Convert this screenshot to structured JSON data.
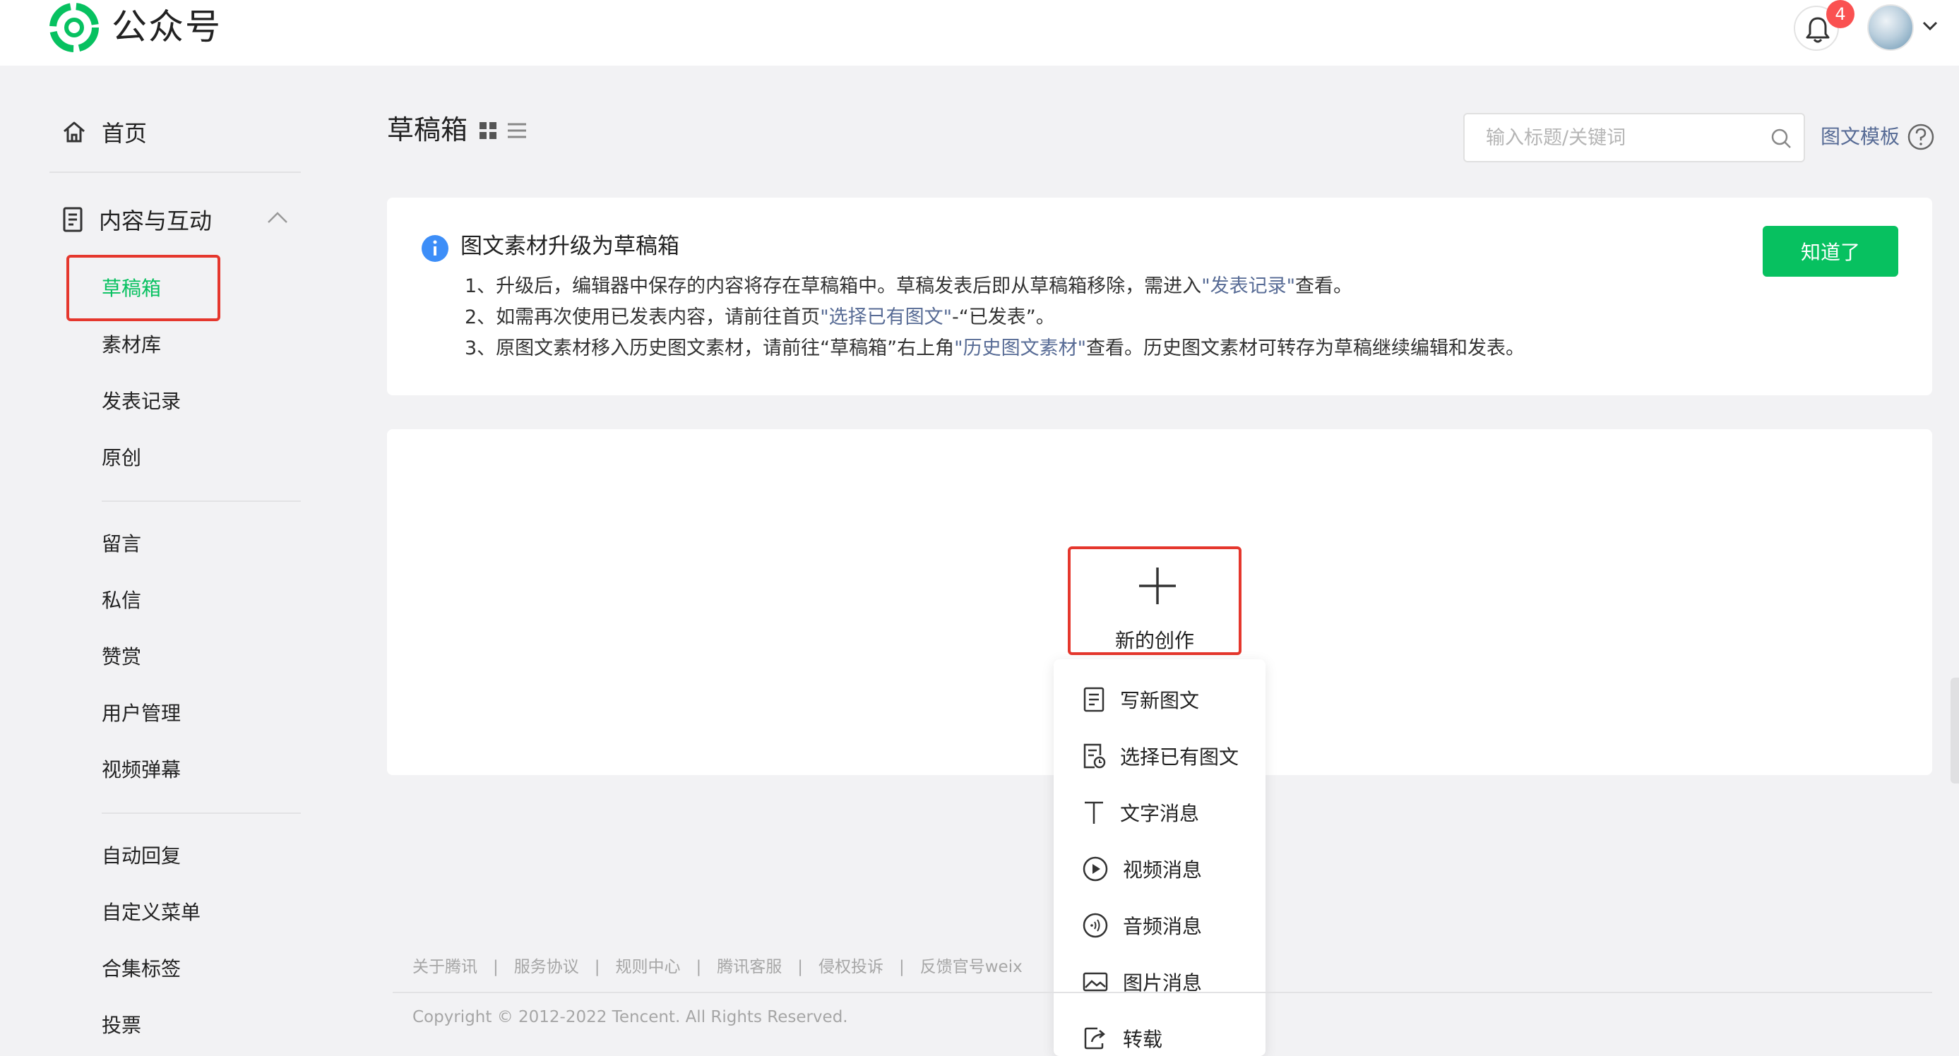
{
  "header": {
    "brand": "公众号",
    "notification_count": "4"
  },
  "sidebar": {
    "home_label": "首页",
    "group_label": "内容与互动",
    "items": [
      {
        "label": "草稿箱",
        "active": true
      },
      {
        "label": "素材库"
      },
      {
        "label": "发表记录"
      },
      {
        "label": "原创"
      },
      {
        "label": "留言"
      },
      {
        "label": "私信"
      },
      {
        "label": "赞赏"
      },
      {
        "label": "用户管理"
      },
      {
        "label": "视频弹幕"
      },
      {
        "label": "自动回复"
      },
      {
        "label": "自定义菜单"
      },
      {
        "label": "合集标签"
      },
      {
        "label": "投票"
      }
    ]
  },
  "main": {
    "title": "草稿箱",
    "search_placeholder": "输入标题/关键词",
    "template_link": "图文模板"
  },
  "notice": {
    "title": "图文素材升级为草稿箱",
    "line1_a": "1、升级后，编辑器中保存的内容将存在草稿箱中。草稿发表后即从草稿箱移除，需进入",
    "line1_link": "\"发表记录\"",
    "line1_b": "查看。",
    "line2_a": "2、如需再次使用已发表内容，请前往首页",
    "line2_link": "\"选择已有图文\"",
    "line2_b": "-“已发表”。",
    "line3_a": "3、原图文素材移入历史图文素材，请前往“草稿箱”右上角",
    "line3_link": "\"历史图文素材\"",
    "line3_b": "查看。历史图文素材可转存为草稿继续编辑和发表。",
    "button": "知道了"
  },
  "create": {
    "label": "新的创作",
    "menu": [
      {
        "label": "写新图文",
        "icon": "doc-icon"
      },
      {
        "label": "选择已有图文",
        "icon": "doc-clock-icon"
      },
      {
        "label": "文字消息",
        "icon": "text-icon"
      },
      {
        "label": "视频消息",
        "icon": "play-icon"
      },
      {
        "label": "音频消息",
        "icon": "audio-icon"
      },
      {
        "label": "图片消息",
        "icon": "image-icon"
      },
      {
        "label": "转载",
        "icon": "share-icon"
      }
    ]
  },
  "footer": {
    "links": [
      "关于腾讯",
      "服务协议",
      "规则中心",
      "腾讯客服",
      "侵权投诉",
      "反馈官号weix"
    ],
    "copyright": "Copyright © 2012-2022 Tencent. All Rights Reserved."
  },
  "colors": {
    "accent": "#07c160",
    "link": "#576b95",
    "highlight": "#e5372d",
    "badge": "#fa5151"
  }
}
